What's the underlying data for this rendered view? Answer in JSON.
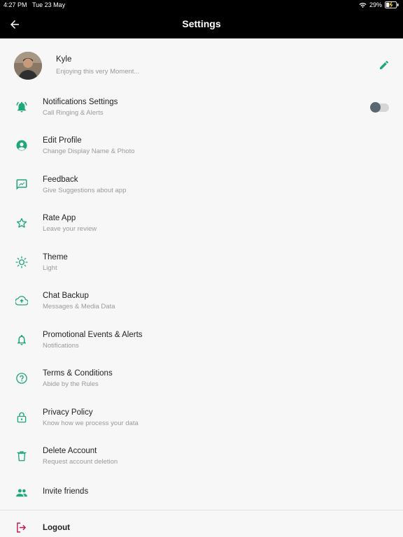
{
  "status_bar": {
    "time": "4:27 PM",
    "date": "Tue 23 May",
    "battery": "29%"
  },
  "header": {
    "title": "Settings"
  },
  "profile": {
    "name": "Kyle",
    "status": "Enjoying this very Moment..."
  },
  "items": [
    {
      "label": "Notifications Settings",
      "sub": "Call Ringing & Alerts",
      "icon": "bell-ringing-icon"
    },
    {
      "label": "Edit Profile",
      "sub": "Change Display Name & Photo",
      "icon": "account-circle-icon"
    },
    {
      "label": "Feedback",
      "sub": "Give Suggestions about app",
      "icon": "feedback-icon"
    },
    {
      "label": "Rate App",
      "sub": "Leave your review",
      "icon": "star-icon"
    },
    {
      "label": "Theme",
      "sub": "Light",
      "icon": "sun-icon"
    },
    {
      "label": "Chat Backup",
      "sub": "Messages & Media Data",
      "icon": "cloud-upload-icon"
    },
    {
      "label": "Promotional Events & Alerts",
      "sub": "Notifications",
      "icon": "bell-icon"
    },
    {
      "label": "Terms & Conditions",
      "sub": "Abide by the Rules",
      "icon": "help-circle-icon"
    },
    {
      "label": "Privacy Policy",
      "sub": "Know how we process your data",
      "icon": "lock-icon"
    },
    {
      "label": "Delete Account",
      "sub": "Request account deletion",
      "icon": "trash-icon"
    },
    {
      "label": "Invite friends",
      "sub": "",
      "icon": "people-icon"
    }
  ],
  "notifications_toggle": {
    "on": false
  },
  "logout": {
    "label": "Logout"
  },
  "colors": {
    "accent": "#1fa67a",
    "logout": "#c2185b",
    "header_bg": "#000000",
    "background": "#f7f7f7"
  }
}
